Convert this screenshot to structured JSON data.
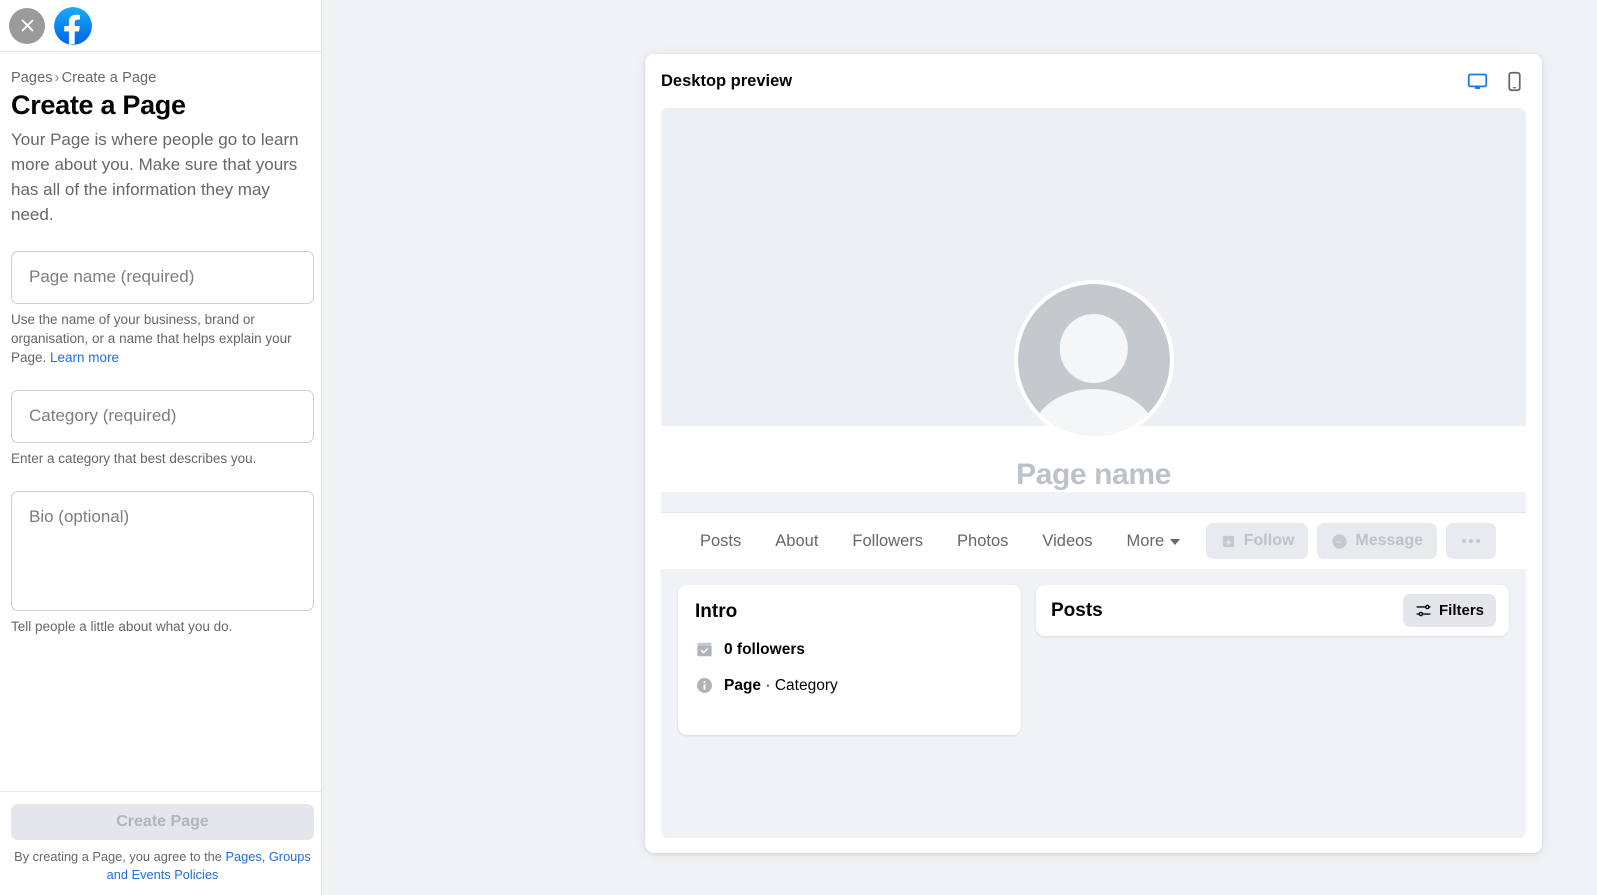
{
  "sidebar": {
    "topbar": {
      "close_icon": "close-icon",
      "brand_icon": "facebook-logo"
    },
    "breadcrumb": {
      "parent": "Pages",
      "separator": "›",
      "current": "Create a Page"
    },
    "title": "Create a Page",
    "description": "Your Page is where people go to learn more about you. Make sure that yours has all of the information they may need.",
    "fields": [
      {
        "name": "page-name",
        "placeholder": "Page name (required)",
        "value": "",
        "helper_prefix": "Use the name of your business, brand or organisation, or a name that helps explain your Page. ",
        "helper_link": "Learn more"
      },
      {
        "name": "category",
        "placeholder": "Category (required)",
        "value": "",
        "helper_prefix": "Enter a category that best describes you.",
        "helper_link": ""
      },
      {
        "name": "bio",
        "placeholder": "Bio (optional)",
        "value": "",
        "helper_prefix": "Tell people a little about what you do.",
        "helper_link": ""
      }
    ],
    "footer": {
      "create_button": "Create Page",
      "tos_prefix": "By creating a Page, you agree to the ",
      "tos_link": "Pages, Groups and Events Policies"
    }
  },
  "preview": {
    "header": {
      "title": "Desktop preview",
      "desktop_icon": "desktop-monitor-icon",
      "mobile_icon": "mobile-phone-icon",
      "active_device": "desktop",
      "accent_color": "#1877f2"
    },
    "profile": {
      "page_name": "Page name",
      "avatar_icon": "default-avatar-icon"
    },
    "tabs": [
      {
        "label": "Posts"
      },
      {
        "label": "About"
      },
      {
        "label": "Followers"
      },
      {
        "label": "Photos"
      },
      {
        "label": "Videos"
      },
      {
        "label": "More",
        "has_caret": true
      }
    ],
    "actions": [
      {
        "label": "Follow",
        "icon": "follow-plus-icon"
      },
      {
        "label": "Message",
        "icon": "messenger-icon"
      },
      {
        "label": "",
        "icon": "ellipsis-icon"
      }
    ],
    "intro": {
      "title": "Intro",
      "rows": [
        {
          "icon": "followers-check-icon",
          "text": "0 followers",
          "bold": true
        },
        {
          "icon": "info-circle-icon",
          "text_bold": "Page",
          "text_rest": " · Category"
        }
      ]
    },
    "posts": {
      "title": "Posts",
      "filters_label": "Filters",
      "filters_icon": "sliders-filter-icon"
    }
  },
  "colors": {
    "page_background": "#f0f2f5",
    "panel_background": "#ffffff",
    "accent_blue": "#1877f2",
    "link_blue": "#216fdb",
    "muted_text": "#65676b",
    "disabled_text": "#bdc2c9"
  }
}
